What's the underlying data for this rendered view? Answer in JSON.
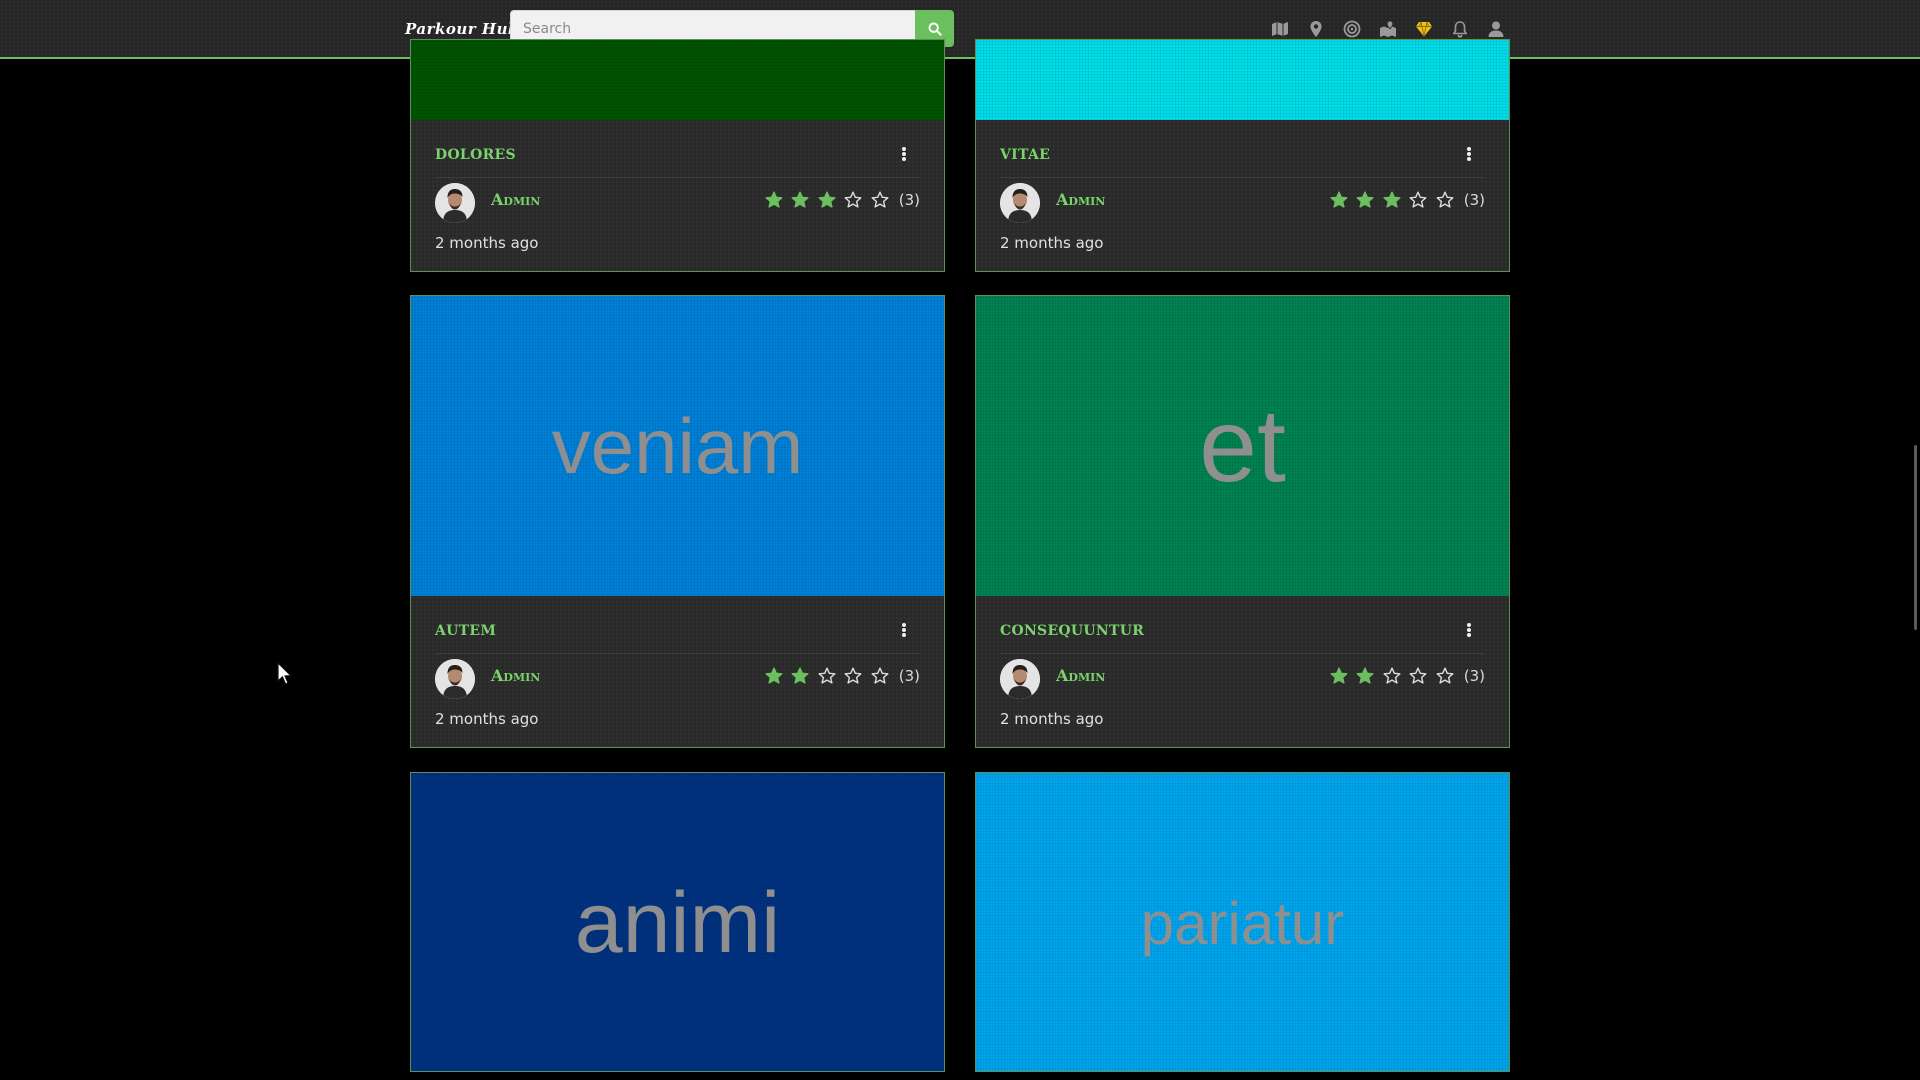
{
  "app": {
    "brand": "Parkour Hub"
  },
  "search": {
    "placeholder": "Search"
  },
  "nav": {
    "icons": [
      "map-icon",
      "map-marker-icon",
      "bullseye-icon",
      "map-pins-icon",
      "gem-icon",
      "bell-icon",
      "user-icon"
    ],
    "accent": "#6bbf5f",
    "gem_color": "#f0c419"
  },
  "cards": [
    {
      "title": "dolores",
      "image_text": "",
      "image_color": "#005400",
      "author": "Admin",
      "rating": 3,
      "max_rating": 5,
      "count": "(3)",
      "time": "2 months ago"
    },
    {
      "title": "vitae",
      "image_text": "",
      "image_color": "#00dde8",
      "author": "Admin",
      "rating": 3,
      "max_rating": 5,
      "count": "(3)",
      "time": "2 months ago"
    },
    {
      "title": "autem",
      "image_text": "veniam",
      "image_color": "#0080d8",
      "author": "Admin",
      "rating": 2,
      "max_rating": 5,
      "count": "(3)",
      "time": "2 months ago"
    },
    {
      "title": "consequuntur",
      "image_text": "et",
      "image_color": "#008251",
      "author": "Admin",
      "rating": 2,
      "max_rating": 5,
      "count": "(3)",
      "time": "2 months ago"
    },
    {
      "title": "",
      "image_text": "animi",
      "image_color": "#003281",
      "author": "",
      "rating": 0,
      "max_rating": 5,
      "count": "",
      "time": ""
    },
    {
      "title": "",
      "image_text": "pariatur",
      "image_color": "#00a4ee",
      "author": "",
      "rating": 0,
      "max_rating": 5,
      "count": "",
      "time": ""
    }
  ],
  "colors": {
    "star_filled": "#6bbf5f",
    "title": "#7bd36d"
  }
}
